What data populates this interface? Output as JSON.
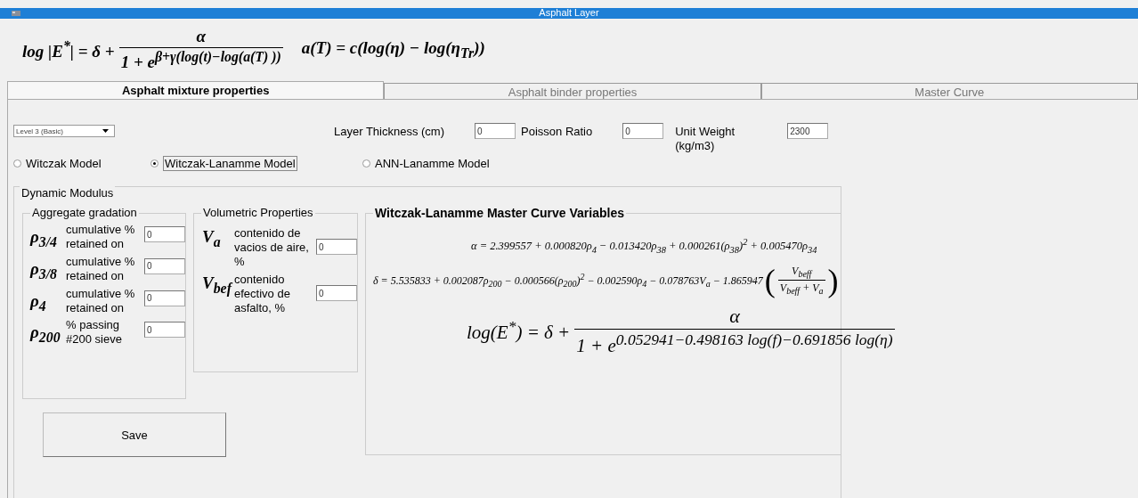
{
  "window": {
    "title": "Asphalt Layer"
  },
  "header_formulas": [
    {
      "parts": [
        {
          "kind": "text",
          "text": "log |E$^{*}$| = δ +"
        },
        {
          "kind": "fraction",
          "numerator": "α",
          "denominator": "1 + e$^{β+γ(log(t)−log(a(T) ))}$"
        }
      ]
    },
    {
      "parts": [
        {
          "kind": "text",
          "text": "a(T) = c(log(η) − log(η$_{Tr}$))"
        }
      ]
    }
  ],
  "tabs": [
    {
      "label": "Asphalt mixture properties",
      "selected": true
    },
    {
      "label": "Asphalt binder properties",
      "selected": false
    },
    {
      "label": "Master Curve",
      "selected": false
    }
  ],
  "level_dropdown": {
    "value": "Level 3 (Basic)"
  },
  "top_fields": [
    {
      "label": "Layer Thickness (cm)",
      "value": "0"
    },
    {
      "label": "Poisson Ratio",
      "value": "0"
    },
    {
      "label": "Unit Weight (kg/m3)",
      "value": "2300"
    }
  ],
  "models": [
    {
      "label": "Witczak Model",
      "selected": false
    },
    {
      "label": "Witczak-Lanamme Model",
      "selected": true
    },
    {
      "label": "ANN-Lanamme Model",
      "selected": false
    }
  ],
  "dynamic_modulus": {
    "title": "Dynamic Modulus",
    "aggregate_gradation": {
      "title": "Aggregate gradation",
      "rows": [
        {
          "symbol": "ρ$_{3/4}$",
          "label": "cumulative % retained on",
          "value": "0"
        },
        {
          "symbol": "ρ$_{3/8}$",
          "label": "cumulative % retained on",
          "value": "0"
        },
        {
          "symbol": "ρ$_{4}$",
          "label": "cumulative % retained on",
          "value": "0"
        },
        {
          "symbol": "ρ$_{200}$",
          "label": "% passing #200 sieve",
          "value": "0"
        }
      ]
    },
    "volumetric_properties": {
      "title": "Volumetric Properties",
      "rows": [
        {
          "symbol": "V$_{a}$",
          "label": "contenido de vacios de aire, %",
          "value": "0"
        },
        {
          "symbol": "V$_{bef}$",
          "label": "contenido efectivo de asfalto, %",
          "value": "0"
        }
      ]
    },
    "master_curve_variables": {
      "title": "Witczak-Lanamme Master Curve Variables",
      "formulas": [
        {
          "parts": [
            {
              "kind": "text",
              "text": "α = 2.399557 + 0.000820ρ$_{4}$ − 0.013420ρ$_{38}$ + 0.000261(ρ$_{38}$)$^{2}$ + 0.005470ρ$_{34}$"
            }
          ]
        },
        {
          "parts": [
            {
              "kind": "text",
              "text": "δ = 5.535833 + 0.002087ρ$_{200}$ − 0.000566(ρ$_{200}$)$^{2}$ − 0.002590ρ$_{4}$ − 0.078763V$_{a}$ − 1.865947"
            },
            {
              "kind": "paren_fraction",
              "open": "(",
              "numerator": "V$_{beff}$",
              "denominator": "V$_{beff}$ + V$_{a}$",
              "close": ")"
            }
          ]
        },
        {
          "parts": [
            {
              "kind": "text",
              "text": "log(E$^{*}$) = δ +"
            },
            {
              "kind": "fraction",
              "numerator": "α",
              "denominator": "1 + e$^{0.052941−0.498163 log(f)−0.691856 log(η)}$"
            }
          ]
        }
      ]
    }
  },
  "save_button": {
    "label": "Save"
  }
}
